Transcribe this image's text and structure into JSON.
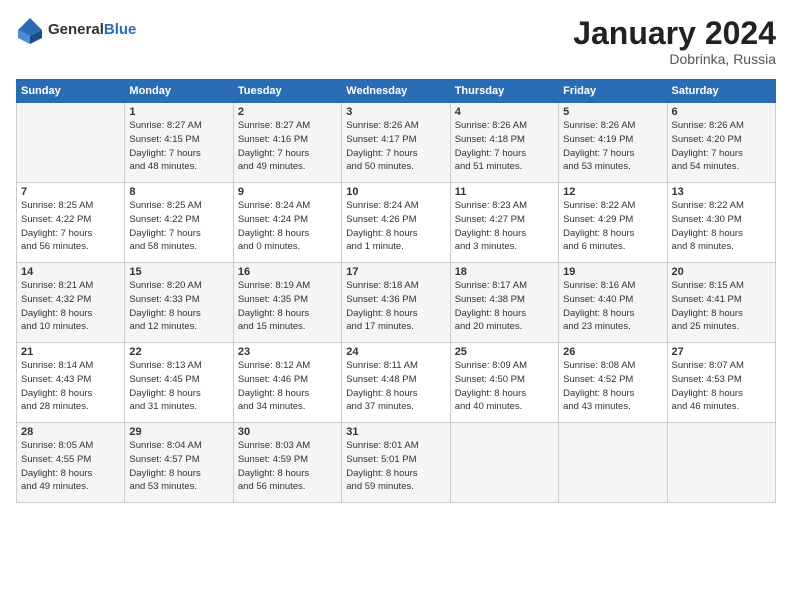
{
  "header": {
    "logo_general": "General",
    "logo_blue": "Blue",
    "month_year": "January 2024",
    "location": "Dobrinka, Russia"
  },
  "weekdays": [
    "Sunday",
    "Monday",
    "Tuesday",
    "Wednesday",
    "Thursday",
    "Friday",
    "Saturday"
  ],
  "weeks": [
    [
      {
        "day": "",
        "info": ""
      },
      {
        "day": "1",
        "info": "Sunrise: 8:27 AM\nSunset: 4:15 PM\nDaylight: 7 hours\nand 48 minutes."
      },
      {
        "day": "2",
        "info": "Sunrise: 8:27 AM\nSunset: 4:16 PM\nDaylight: 7 hours\nand 49 minutes."
      },
      {
        "day": "3",
        "info": "Sunrise: 8:26 AM\nSunset: 4:17 PM\nDaylight: 7 hours\nand 50 minutes."
      },
      {
        "day": "4",
        "info": "Sunrise: 8:26 AM\nSunset: 4:18 PM\nDaylight: 7 hours\nand 51 minutes."
      },
      {
        "day": "5",
        "info": "Sunrise: 8:26 AM\nSunset: 4:19 PM\nDaylight: 7 hours\nand 53 minutes."
      },
      {
        "day": "6",
        "info": "Sunrise: 8:26 AM\nSunset: 4:20 PM\nDaylight: 7 hours\nand 54 minutes."
      }
    ],
    [
      {
        "day": "7",
        "info": "Sunrise: 8:25 AM\nSunset: 4:22 PM\nDaylight: 7 hours\nand 56 minutes."
      },
      {
        "day": "8",
        "info": "Sunrise: 8:25 AM\nSunset: 4:22 PM\nDaylight: 7 hours\nand 58 minutes."
      },
      {
        "day": "9",
        "info": "Sunrise: 8:24 AM\nSunset: 4:24 PM\nDaylight: 8 hours\nand 0 minutes."
      },
      {
        "day": "10",
        "info": "Sunrise: 8:24 AM\nSunset: 4:26 PM\nDaylight: 8 hours\nand 1 minute."
      },
      {
        "day": "11",
        "info": "Sunrise: 8:23 AM\nSunset: 4:27 PM\nDaylight: 8 hours\nand 3 minutes."
      },
      {
        "day": "12",
        "info": "Sunrise: 8:22 AM\nSunset: 4:29 PM\nDaylight: 8 hours\nand 6 minutes."
      },
      {
        "day": "13",
        "info": "Sunrise: 8:22 AM\nSunset: 4:30 PM\nDaylight: 8 hours\nand 8 minutes."
      }
    ],
    [
      {
        "day": "14",
        "info": "Sunrise: 8:21 AM\nSunset: 4:32 PM\nDaylight: 8 hours\nand 10 minutes."
      },
      {
        "day": "15",
        "info": "Sunrise: 8:20 AM\nSunset: 4:33 PM\nDaylight: 8 hours\nand 12 minutes."
      },
      {
        "day": "16",
        "info": "Sunrise: 8:19 AM\nSunset: 4:35 PM\nDaylight: 8 hours\nand 15 minutes."
      },
      {
        "day": "17",
        "info": "Sunrise: 8:18 AM\nSunset: 4:36 PM\nDaylight: 8 hours\nand 17 minutes."
      },
      {
        "day": "18",
        "info": "Sunrise: 8:17 AM\nSunset: 4:38 PM\nDaylight: 8 hours\nand 20 minutes."
      },
      {
        "day": "19",
        "info": "Sunrise: 8:16 AM\nSunset: 4:40 PM\nDaylight: 8 hours\nand 23 minutes."
      },
      {
        "day": "20",
        "info": "Sunrise: 8:15 AM\nSunset: 4:41 PM\nDaylight: 8 hours\nand 25 minutes."
      }
    ],
    [
      {
        "day": "21",
        "info": "Sunrise: 8:14 AM\nSunset: 4:43 PM\nDaylight: 8 hours\nand 28 minutes."
      },
      {
        "day": "22",
        "info": "Sunrise: 8:13 AM\nSunset: 4:45 PM\nDaylight: 8 hours\nand 31 minutes."
      },
      {
        "day": "23",
        "info": "Sunrise: 8:12 AM\nSunset: 4:46 PM\nDaylight: 8 hours\nand 34 minutes."
      },
      {
        "day": "24",
        "info": "Sunrise: 8:11 AM\nSunset: 4:48 PM\nDaylight: 8 hours\nand 37 minutes."
      },
      {
        "day": "25",
        "info": "Sunrise: 8:09 AM\nSunset: 4:50 PM\nDaylight: 8 hours\nand 40 minutes."
      },
      {
        "day": "26",
        "info": "Sunrise: 8:08 AM\nSunset: 4:52 PM\nDaylight: 8 hours\nand 43 minutes."
      },
      {
        "day": "27",
        "info": "Sunrise: 8:07 AM\nSunset: 4:53 PM\nDaylight: 8 hours\nand 46 minutes."
      }
    ],
    [
      {
        "day": "28",
        "info": "Sunrise: 8:05 AM\nSunset: 4:55 PM\nDaylight: 8 hours\nand 49 minutes."
      },
      {
        "day": "29",
        "info": "Sunrise: 8:04 AM\nSunset: 4:57 PM\nDaylight: 8 hours\nand 53 minutes."
      },
      {
        "day": "30",
        "info": "Sunrise: 8:03 AM\nSunset: 4:59 PM\nDaylight: 8 hours\nand 56 minutes."
      },
      {
        "day": "31",
        "info": "Sunrise: 8:01 AM\nSunset: 5:01 PM\nDaylight: 8 hours\nand 59 minutes."
      },
      {
        "day": "",
        "info": ""
      },
      {
        "day": "",
        "info": ""
      },
      {
        "day": "",
        "info": ""
      }
    ]
  ]
}
